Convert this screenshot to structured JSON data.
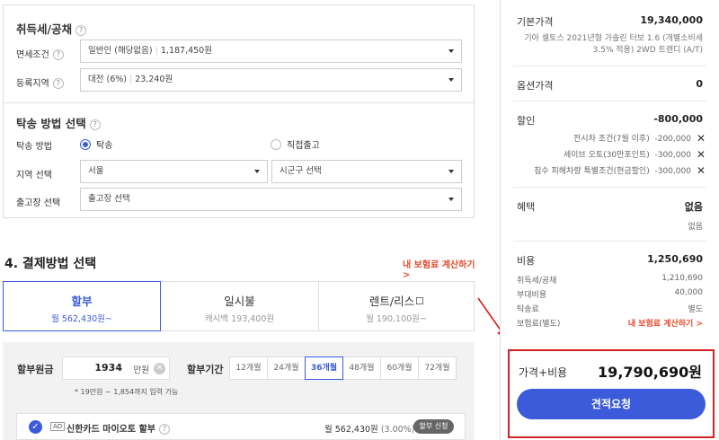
{
  "tax": {
    "title": "취득세/공채",
    "help": "?",
    "exemption_label": "면세조건",
    "exemption_value": "일반인 (해당없음)",
    "exemption_amount": "1,187,450원",
    "region_label": "등록지역",
    "region_value": "대전 (6%)",
    "region_amount": "23,240원"
  },
  "delivery": {
    "title": "탁송 방법 선택",
    "help": "?",
    "method_label": "탁송 방법",
    "option_delivery": "탁송",
    "option_pickup": "직접출고",
    "region_label": "지역 선택",
    "region_value": "서울",
    "district_value": "시군구 선택",
    "center_label": "출고장 선택",
    "center_value": "출고장 선택"
  },
  "payment": {
    "title": "4. 결제방법 선택",
    "insurance_link": "내 보험료 계산하기 >",
    "tabs": [
      {
        "label": "할부",
        "sub": "월 562,430원~"
      },
      {
        "label": "일시불",
        "sub": "캐시백 193,400원"
      },
      {
        "label": "렌트/리스",
        "sub": "월 190,100원~"
      }
    ],
    "principal_label": "할부원금",
    "principal_value": "1934",
    "principal_unit": "만원",
    "period_label": "할부기간",
    "months": [
      "12개월",
      "24개월",
      "36개월",
      "48개월",
      "60개월",
      "72개월"
    ],
    "selected_month": "36개월",
    "hint": "* 19만원 ~ 1,854까지 입력 가능",
    "card": {
      "ad": "AD",
      "name": "신한카드 마이오토 할부",
      "help": "?",
      "amount": "월 562,430원",
      "rate": "(3.00%)",
      "button": "할부 신청"
    }
  },
  "summary": {
    "base_label": "기본가격",
    "base_value": "19,340,000",
    "base_desc": "기아 셀토스 2021년형 가솔린 터보 1.6 (개별소비세 3.5% 적용) 2WD 트렌디 (A/T)",
    "option_label": "옵션가격",
    "option_value": "0",
    "discount_label": "할인",
    "discount_value": "-800,000",
    "discounts": [
      {
        "label": "전시차 조건(7월 이후)",
        "value": "-200,000"
      },
      {
        "label": "세이브 오토(30만포인트)",
        "value": "-300,000"
      },
      {
        "label": "침수 피해차량 특별조건(현금할인)",
        "value": "-300,000"
      }
    ],
    "benefit_label": "혜택",
    "benefit_value": "없음",
    "benefit_sub": "없음",
    "cost_label": "비용",
    "cost_value": "1,250,690",
    "costs": [
      {
        "label": "취득세/공채",
        "value": "1,210,690"
      },
      {
        "label": "부대비용",
        "value": "40,000"
      },
      {
        "label": "탁송료",
        "value": "별도"
      },
      {
        "label": "보험료(별도)",
        "value": "내 보험료 계산하기 >"
      }
    ],
    "total_label": "가격+비용",
    "total_value": "19,790,690원",
    "quote_button": "견적요청"
  },
  "colors": {
    "accent": "#3b5bdb",
    "highlight": "#d32222",
    "link": "#e64a2e"
  }
}
